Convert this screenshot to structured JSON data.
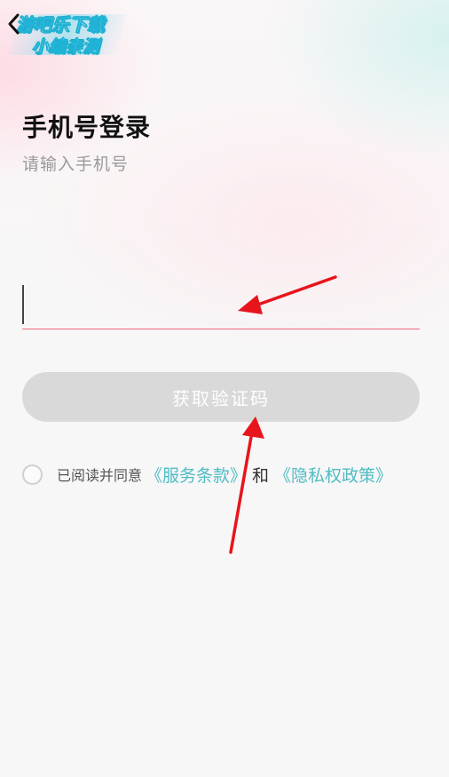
{
  "header": {
    "back_icon": "chevron-left-icon",
    "watermark": {
      "line1": "游吧乐下载",
      "line2": "小编亲测"
    }
  },
  "login": {
    "title": "手机号登录",
    "subtitle": "请输入手机号",
    "phone_input": {
      "value": "",
      "placeholder": ""
    },
    "get_code_label": "获取验证码"
  },
  "agreement": {
    "prefix": "已阅读并同意",
    "terms_link": "《服务条款》",
    "conjunction": "和",
    "privacy_link": "《隐私权政策》",
    "checked": false
  },
  "colors": {
    "accent_link": "#4fbcc4",
    "input_underline": "#f06a7e",
    "button_disabled": "#d9d9d9",
    "annotation_arrow": "#e8141c"
  }
}
